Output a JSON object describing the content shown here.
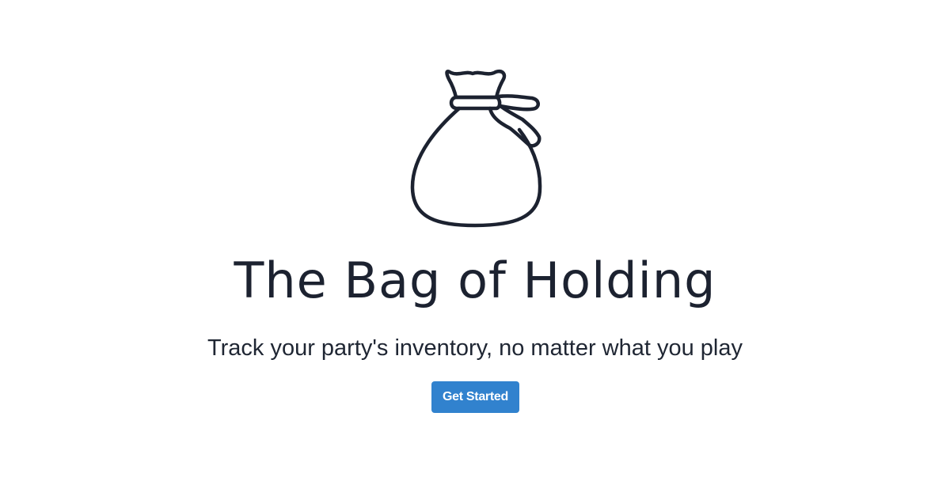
{
  "hero": {
    "logo_icon": "bag-of-holding-icon",
    "title": "The Bag of Holding",
    "subtitle": "Track your party's inventory, no matter what you play",
    "cta_label": "Get Started"
  },
  "colors": {
    "background": "#ffffff",
    "text": "#1c2230",
    "accent": "#3182ce",
    "button_text": "#ffffff"
  }
}
